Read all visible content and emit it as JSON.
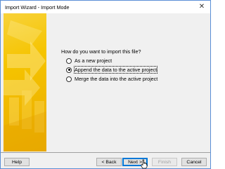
{
  "window": {
    "title": "Import Wizard - Import Mode",
    "close_glyph": "✕"
  },
  "main": {
    "question": "How do you want to import this file?",
    "options": [
      {
        "label": "As a new project",
        "selected": false
      },
      {
        "label": "Append the data to the active project",
        "selected": true
      },
      {
        "label": "Merge the data into the active project",
        "selected": false
      }
    ]
  },
  "buttons": {
    "help": "Help",
    "back": "< Back",
    "next": "Next >",
    "finish": "Finish",
    "cancel": "Cancel"
  },
  "colors": {
    "accent": "#0078d7",
    "side_panel": "#f5c400"
  }
}
